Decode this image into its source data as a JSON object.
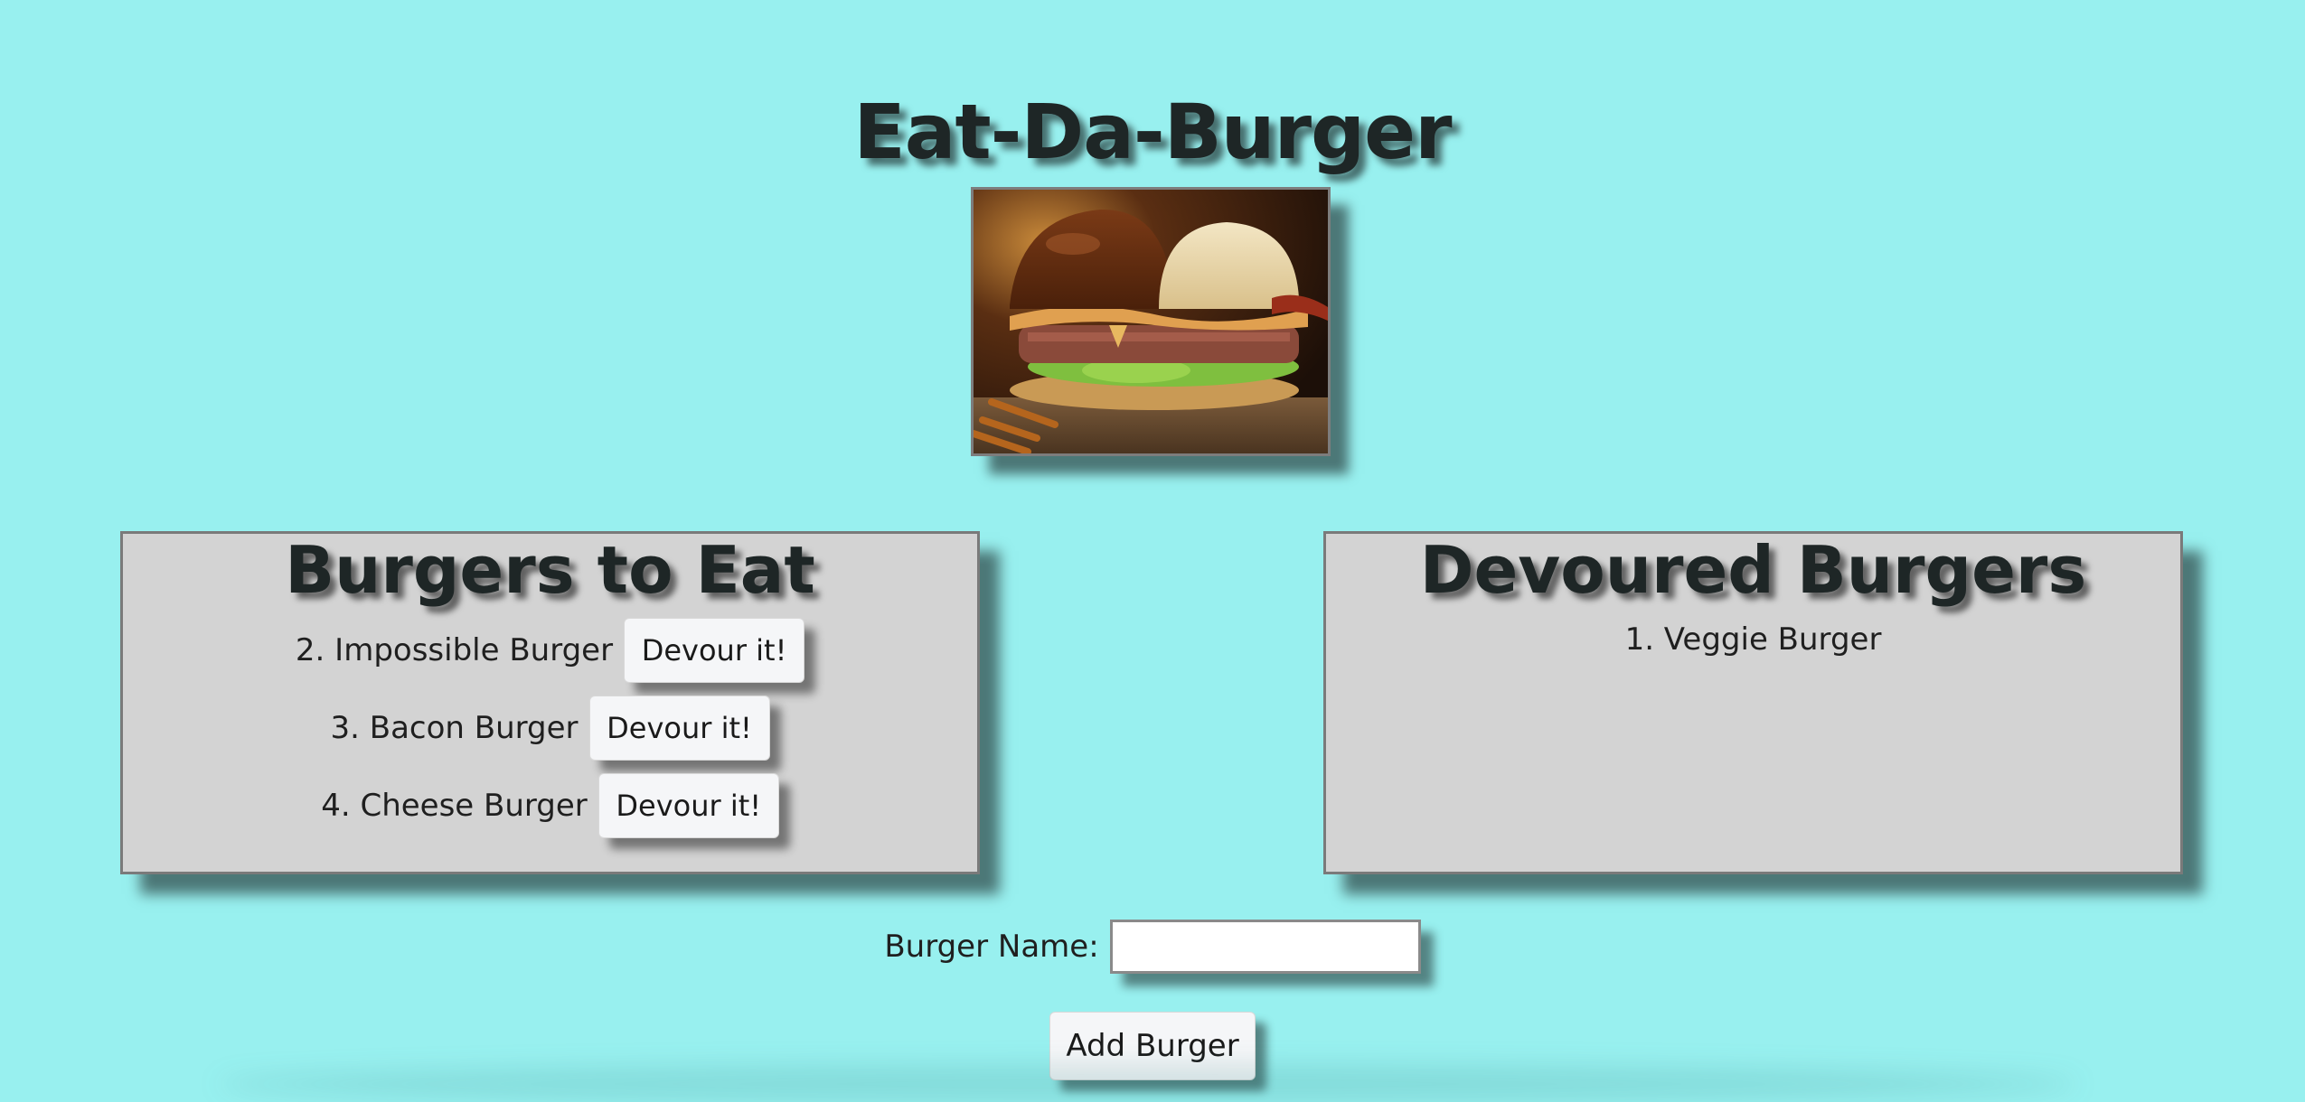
{
  "header": {
    "title": "Eat-Da-Burger"
  },
  "hero": {
    "image_subject": "burger-photo"
  },
  "to_eat": {
    "heading": "Burgers to Eat",
    "items": [
      {
        "label": "2. Impossible Burger",
        "button": "Devour it!"
      },
      {
        "label": "3. Bacon Burger",
        "button": "Devour it!"
      },
      {
        "label": "4. Cheese Burger",
        "button": "Devour it!"
      }
    ]
  },
  "devoured": {
    "heading": "Devoured Burgers",
    "items": [
      {
        "label": "1. Veggie Burger"
      }
    ]
  },
  "form": {
    "label": "Burger Name:",
    "input_value": "",
    "submit_label": "Add Burger"
  },
  "colors": {
    "background": "#98f0ef",
    "panel": "#d3d3d3",
    "button": "#f5f6f8"
  }
}
